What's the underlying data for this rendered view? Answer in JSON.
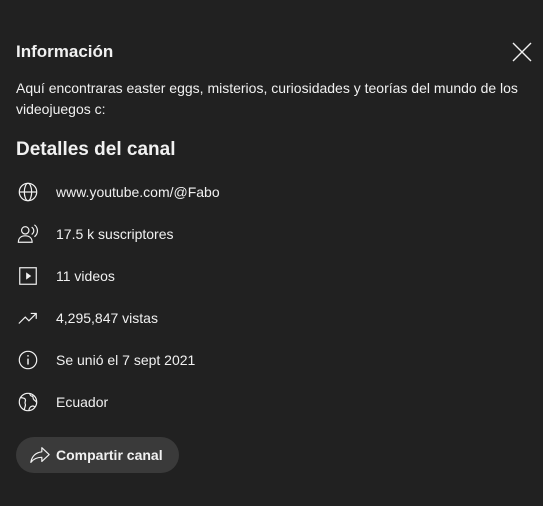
{
  "dialog": {
    "title": "Información",
    "description": "Aquí encontraras easter eggs, misterios, curiosidades y teorías del mundo de los videojuegos c:",
    "close_icon": "close-icon"
  },
  "details": {
    "title": "Detalles del canal",
    "items": [
      {
        "icon": "globe-icon",
        "text": "www.youtube.com/@Fabo"
      },
      {
        "icon": "subscribers-icon",
        "text": "17.5 k suscriptores"
      },
      {
        "icon": "video-icon",
        "text": "11 videos"
      },
      {
        "icon": "trending-icon",
        "text": "4,295,847 vistas"
      },
      {
        "icon": "info-icon",
        "text": "Se unió el 7 sept 2021"
      },
      {
        "icon": "location-globe-icon",
        "text": "Ecuador"
      }
    ]
  },
  "share": {
    "label": "Compartir canal",
    "icon": "share-icon"
  },
  "colors": {
    "background": "#212121",
    "text": "#f1f1f1",
    "button_bg": "#3a3a3a"
  }
}
